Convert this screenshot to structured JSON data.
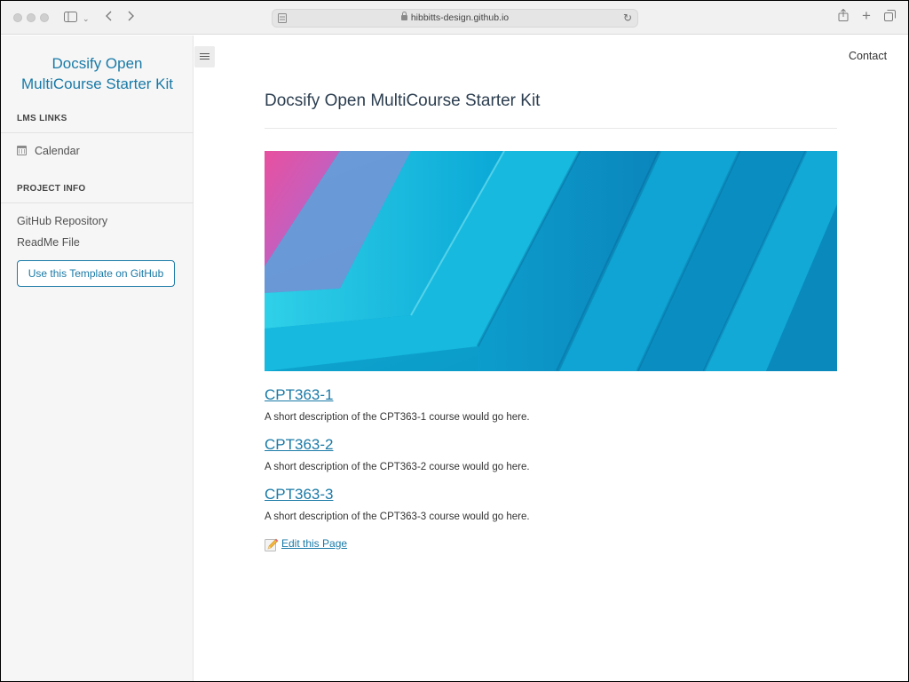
{
  "browser": {
    "url": "hibbitts-design.github.io"
  },
  "sidebar": {
    "app_name_line1": "Docsify Open",
    "app_name_line2": "MultiCourse Starter Kit",
    "sections": [
      {
        "title": "LMS LINKS",
        "items": [
          {
            "label": "Calendar",
            "icon": "calendar-icon"
          }
        ]
      },
      {
        "title": "PROJECT INFO",
        "items": [
          {
            "label": "GitHub Repository"
          },
          {
            "label": "ReadMe File"
          }
        ]
      }
    ],
    "template_button": "Use this Template on GitHub"
  },
  "nav": {
    "contact": "Contact"
  },
  "main": {
    "title": "Docsify Open MultiCourse Starter Kit",
    "courses": [
      {
        "name": "CPT363-1",
        "description": "A short description of the CPT363-1 course would go here."
      },
      {
        "name": "CPT363-2",
        "description": "A short description of the CPT363-2 course would go here."
      },
      {
        "name": "CPT363-3",
        "description": "A short description of the CPT363-3 course would go here."
      }
    ],
    "edit_link": "Edit this Page"
  },
  "colors": {
    "link": "#1a7aa7",
    "hero_primary": "#0aa5d2",
    "hero_accent": "#e055b3"
  }
}
